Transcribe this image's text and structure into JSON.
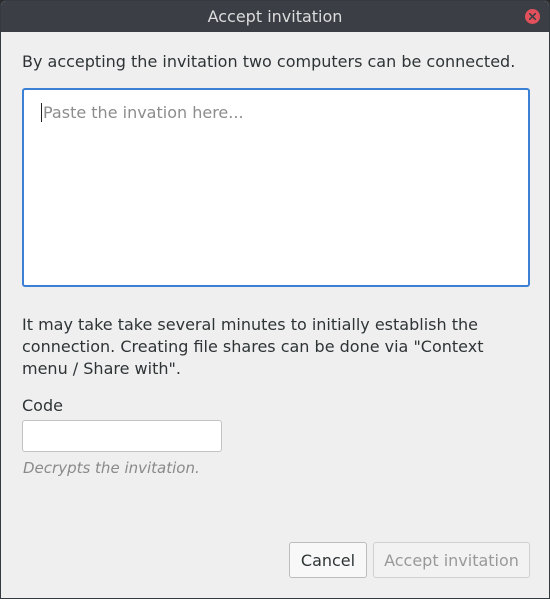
{
  "window": {
    "title": "Accept invitation"
  },
  "dialog": {
    "intro_text": "By accepting the invitation two computers can be connected.",
    "invitation_placeholder": "Paste the invation here...",
    "info_text": "It may take take several minutes to initially establish the connection. Creating file shares can be done via \"Context menu / Share with\".",
    "code_label": "Code",
    "code_value": "",
    "code_hint": "Decrypts the invitation.",
    "cancel_label": "Cancel",
    "accept_label": "Accept invitation"
  },
  "colors": {
    "titlebar": "#3b3f45",
    "close_button": "#e2505b",
    "focus_border": "#3b80d4",
    "background": "#efefef"
  },
  "icons": {
    "close": "close-icon"
  }
}
